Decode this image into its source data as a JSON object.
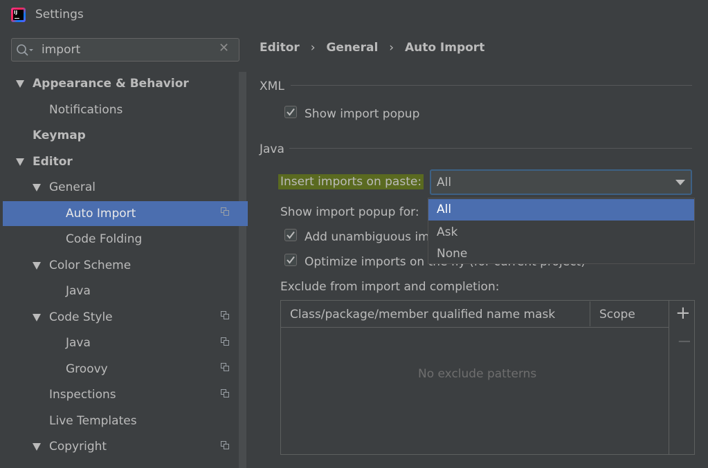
{
  "window": {
    "title": "Settings"
  },
  "search": {
    "value": "import"
  },
  "tree": {
    "items": [
      {
        "label": "Appearance & Behavior"
      },
      {
        "label": "Notifications"
      },
      {
        "label": "Keymap"
      },
      {
        "label": "Editor"
      },
      {
        "label": "General"
      },
      {
        "label": "Auto Import"
      },
      {
        "label": "Code Folding"
      },
      {
        "label": "Color Scheme"
      },
      {
        "label": "Java"
      },
      {
        "label": "Code Style"
      },
      {
        "label": "Java"
      },
      {
        "label": "Groovy"
      },
      {
        "label": "Inspections"
      },
      {
        "label": "Live Templates"
      },
      {
        "label": "Copyright"
      }
    ]
  },
  "breadcrumb": {
    "items": [
      "Editor",
      "General",
      "Auto Import"
    ],
    "separator": "›"
  },
  "xml": {
    "section": "XML",
    "show_import_popup": {
      "label": "Show import popup",
      "checked": true
    }
  },
  "java": {
    "section": "Java",
    "insert_imports_label": "Insert imports on paste:",
    "insert_imports_value": "All",
    "show_popup_for_label": "Show import popup for:",
    "add_unambiguous": {
      "label": "Add unambiguous im",
      "checked": true
    },
    "optimize_imports": {
      "label": "Optimize imports on the fly (for current project)",
      "checked": true
    },
    "dropdown_options": [
      "All",
      "Ask",
      "None"
    ],
    "dropdown_selected": "All"
  },
  "exclude": {
    "label": "Exclude from import and completion:",
    "columns": [
      "Class/package/member qualified name mask",
      "Scope"
    ],
    "empty_text": "No exclude patterns",
    "add_symbol": "+",
    "remove_symbol": "−"
  },
  "colors": {
    "accent": "#4b6eaf",
    "highlight": "#5a6a20",
    "background": "#3c3f41"
  }
}
